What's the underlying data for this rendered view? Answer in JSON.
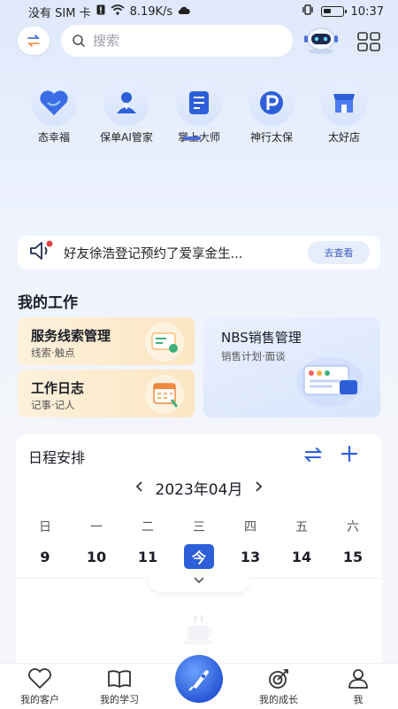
{
  "status_bar": {
    "carrier": "没有 SIM 卡",
    "speed": "8.19K/s",
    "time": "10:37"
  },
  "search": {
    "placeholder": "搜索"
  },
  "apps": [
    {
      "label": "态幸福",
      "icon": "heart-icon"
    },
    {
      "label": "保单AI管家",
      "icon": "agent-icon"
    },
    {
      "label": "掌上大师",
      "icon": "document-icon"
    },
    {
      "label": "神行太保",
      "icon": "p-logo-icon"
    },
    {
      "label": "太好店",
      "icon": "store-icon"
    }
  ],
  "notice": {
    "text": "好友徐浩登记预约了爱享金生...",
    "button": "去查看"
  },
  "work": {
    "title": "我的工作",
    "cards": [
      {
        "title": "服务线索管理",
        "sub": "线索·触点"
      },
      {
        "title": "工作日志",
        "sub": "记事·记人"
      },
      {
        "title": "NBS销售管理",
        "sub": "销售计划·面谈"
      }
    ]
  },
  "schedule": {
    "title": "日程安排",
    "month": "2023年04月",
    "days": [
      {
        "weekday": "日",
        "num": "9"
      },
      {
        "weekday": "一",
        "num": "10"
      },
      {
        "weekday": "二",
        "num": "11"
      },
      {
        "weekday": "三",
        "num": "今"
      },
      {
        "weekday": "四",
        "num": "13"
      },
      {
        "weekday": "五",
        "num": "14"
      },
      {
        "weekday": "六",
        "num": "15"
      }
    ]
  },
  "tabs": [
    {
      "label": "我的客户",
      "icon": "heart-outline-icon"
    },
    {
      "label": "我的学习",
      "icon": "book-icon"
    },
    {
      "label": "",
      "icon": "rocket-icon"
    },
    {
      "label": "我的成长",
      "icon": "target-icon"
    },
    {
      "label": "我",
      "icon": "person-icon"
    }
  ],
  "colors": {
    "accent": "#2c5fd8",
    "work_card_warm": "#fbe6c2",
    "work_card_cool": "#d9e5fb"
  }
}
